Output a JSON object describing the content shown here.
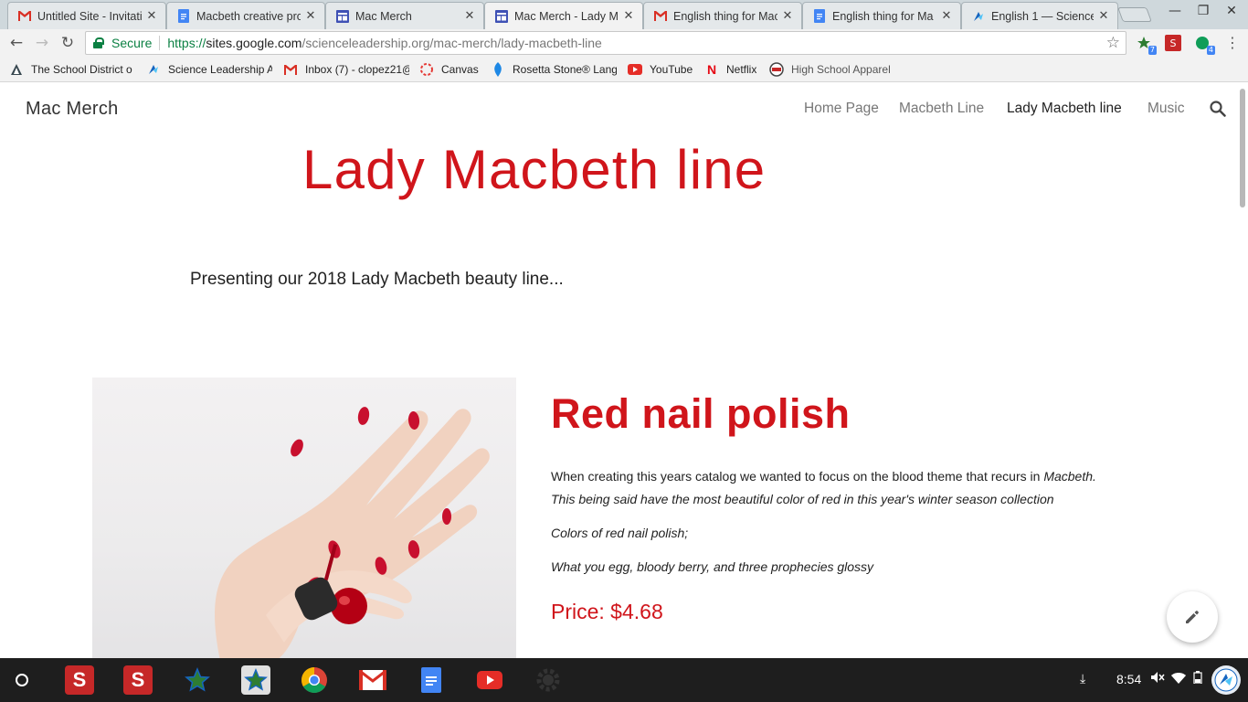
{
  "tabs": [
    {
      "title": "Untitled Site - Invitati",
      "icon": "gmail-icon",
      "active": false
    },
    {
      "title": "Macbeth creative pro",
      "icon": "google-docs-icon",
      "active": false
    },
    {
      "title": "Mac Merch",
      "icon": "google-sites-icon",
      "active": false
    },
    {
      "title": "Mac Merch - Lady Ma",
      "icon": "google-sites-icon",
      "active": true
    },
    {
      "title": "English thing for Mac",
      "icon": "gmail-icon",
      "active": false
    },
    {
      "title": "English thing for Ma",
      "icon": "google-docs-icon",
      "active": false
    },
    {
      "title": "English 1 — Science",
      "icon": "sla-icon",
      "active": false
    }
  ],
  "omnibox": {
    "secure_label": "Secure",
    "url_scheme": "https://",
    "url_host": "sites.google.com",
    "url_path": "/scienceleadership.org/mac-merch/lady-macbeth-line",
    "extension_badge_1": "7",
    "extension_badge_2": "4"
  },
  "bookmarks": [
    {
      "label": "The School District o",
      "icon": "school-district-icon"
    },
    {
      "label": "Science Leadership A",
      "icon": "sla-icon"
    },
    {
      "label": "Inbox (7) - clopez21@",
      "icon": "gmail-icon"
    },
    {
      "label": "Canvas",
      "icon": "canvas-icon"
    },
    {
      "label": "Rosetta Stone® Lang",
      "icon": "rosetta-stone-icon"
    },
    {
      "label": "YouTube",
      "icon": "youtube-icon"
    },
    {
      "label": "Netflix",
      "icon": "netflix-icon"
    },
    {
      "label": "High School Apparel",
      "icon": "apparel-icon"
    }
  ],
  "site": {
    "title": "Mac Merch",
    "nav": [
      {
        "label": "Home Page",
        "active": false
      },
      {
        "label": "Macbeth Line",
        "active": false
      },
      {
        "label": "Lady Macbeth line",
        "active": true
      },
      {
        "label": "Music",
        "active": false
      }
    ]
  },
  "content": {
    "heading": "Lady Macbeth line",
    "intro": "Presenting our 2018 Lady Macbeth beauty line...",
    "product": {
      "title": "Red nail polish",
      "para1_normal": "When creating this years catalog we wanted to focus on the blood theme that recurs in ",
      "para1_italic": "Macbeth.",
      "para2": "This being said have the most beautiful color of red in this year's winter season collection",
      "para3": "Colors of red nail polish;",
      "para4": "What you egg, bloody berry, and three prophecies glossy",
      "price": "Price: $4.68"
    }
  },
  "shelf": {
    "time": "8:54",
    "apps": [
      "schoology-icon",
      "schoology-icon",
      "star-app-icon",
      "star-app-icon",
      "chrome-icon",
      "gmail-icon",
      "google-docs-icon",
      "youtube-icon",
      "settings-icon"
    ]
  },
  "colors": {
    "accent_red": "#d0151b",
    "secure_green": "#0b8043"
  }
}
